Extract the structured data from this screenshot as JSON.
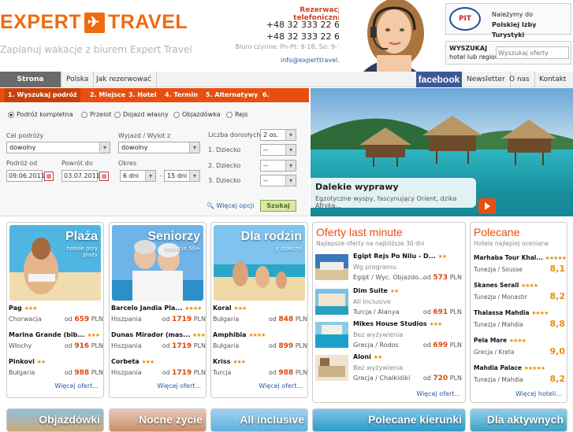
{
  "header": {
    "logo_left": "EXPERT",
    "logo_right": "TRAVEL",
    "tagline": "Zaplanuj wakacje z biurem Expert Travel",
    "phone_label": "Rezerwacja telefoniczna:",
    "phones": [
      "+48 32 333 22 61",
      "+48 32 333 22 69"
    ],
    "hours": "Biuro czynne: Pn-Pt: 9-18, So: 9-13",
    "email": "info@experttravel.pl",
    "pit_logo": "PIT",
    "pit_text_1": "Należymy do",
    "pit_text_2": "Polskiej Izby Turystyki",
    "search_label_1": "WYSZUKAJ",
    "search_label_2": "hotel lub region",
    "search_placeholder": "Wyszukaj oferty"
  },
  "nav": {
    "items": [
      "Strona główna",
      "Polska",
      "Jak rezerwować"
    ],
    "facebook": "facebook",
    "right_items": [
      "Newsletter",
      "O nas",
      "Kontakt"
    ]
  },
  "steps": [
    "1. Wyszukaj podróż",
    "2. Miejsce",
    "3. Hotel",
    "4. Termin",
    "5. Alternatywy",
    "6. Rezerwacja"
  ],
  "search": {
    "radios": [
      "Podróż kompletna",
      "Przelot",
      "Dojazd własny",
      "Objazdówka",
      "Rejs"
    ],
    "origin_label": "Cel podróży",
    "origin_value": "dowolny",
    "depart_label": "Wyjazd / Wylot z",
    "depart_value": "dowolny",
    "from_label": "Podróż od",
    "from_value": "09.06.2011",
    "to_label": "Powrót do",
    "to_value": "03.07.2011",
    "period_label": "Okres",
    "period_from": "6 dni",
    "period_sep": "-",
    "period_to": "15 dni",
    "adults_label": "Liczba dorosłych",
    "adults_value": "2 os.",
    "child1_label": "1. Dziecko",
    "child2_label": "2. Dziecko",
    "child3_label": "3. Dziecko",
    "child_value": "--",
    "more_options": "Więcej opcji",
    "submit": "Szukaj"
  },
  "hero": {
    "title": "Dalekie wyprawy",
    "subtitle": "Egzotyczne wyspy, fascynujący Orient, dzika Afryka..."
  },
  "cards": [
    {
      "title": "Plaża",
      "subtitle": "hotele przy plaży",
      "offers": [
        {
          "name": "Pag",
          "stars": "★★★",
          "country": "Chorwacja",
          "price_prefix": "od",
          "price": "659",
          "currency": "PLN"
        },
        {
          "name": "Marina Grande (bib...",
          "stars": "★★★",
          "country": "Włochy",
          "price_prefix": "od",
          "price": "916",
          "currency": "PLN"
        },
        {
          "name": "Pinkovi",
          "stars": "★★",
          "country": "Bułgaria",
          "price_prefix": "od",
          "price": "988",
          "currency": "PLN"
        }
      ],
      "more": "Więcej ofert..."
    },
    {
      "title": "Seniorzy",
      "subtitle": "wakacje 50+",
      "offers": [
        {
          "name": "Barcelo Jandia Pla...",
          "stars": "★★★★",
          "country": "Hiszpania",
          "price_prefix": "od",
          "price": "1719",
          "currency": "PLN"
        },
        {
          "name": "Dunas Mirador (mas...",
          "stars": "★★★★",
          "country": "Hiszpania",
          "price_prefix": "od",
          "price": "1719",
          "currency": "PLN"
        },
        {
          "name": "Corbeta",
          "stars": "★★★",
          "country": "Hiszpania",
          "price_prefix": "od",
          "price": "1719",
          "currency": "PLN"
        }
      ],
      "more": "Więcej ofert..."
    },
    {
      "title": "Dla rodzin",
      "subtitle": "z dziećmi",
      "offers": [
        {
          "name": "Koral",
          "stars": "★★★",
          "country": "Bułgaria",
          "price_prefix": "od",
          "price": "848",
          "currency": "PLN"
        },
        {
          "name": "Amphibia",
          "stars": "★★★★",
          "country": "Bułgaria",
          "price_prefix": "od",
          "price": "899",
          "currency": "PLN"
        },
        {
          "name": "Kriss",
          "stars": "★★★",
          "country": "Turcja",
          "price_prefix": "od",
          "price": "988",
          "currency": "PLN"
        }
      ],
      "more": "Więcej ofert..."
    }
  ],
  "last_minute": {
    "title": "Oferty last minute",
    "subtitle": "Najlepsze oferty na najbliższe 30 dni",
    "items": [
      {
        "name": "Egipt Rejs Po Nilu - D...",
        "stars": "★★",
        "desc": "Wg programu",
        "country": "Egipt / Wyc. Objazdo...",
        "price_prefix": "od",
        "price": "573",
        "currency": "PLN"
      },
      {
        "name": "Dim Suite",
        "stars": "★★",
        "desc": "All Inclusive",
        "country": "Turcja / Alanya",
        "price_prefix": "od",
        "price": "691",
        "currency": "PLN"
      },
      {
        "name": "Mikes House Studios",
        "stars": "★★★",
        "desc": "Bez wyżywienia",
        "country": "Grecja / Rodos",
        "price_prefix": "od",
        "price": "699",
        "currency": "PLN"
      },
      {
        "name": "Aloni",
        "stars": "★★",
        "desc": "Bez wyżywienia",
        "country": "Grecja / Chalkidiki",
        "price_prefix": "od",
        "price": "720",
        "currency": "PLN"
      }
    ],
    "more": "Więcej ofert..."
  },
  "polecane": {
    "title": "Polecane",
    "subtitle": "Hotele najlepiej oceniane",
    "items": [
      {
        "name": "Marhaba Tour Khal...",
        "stars": "★★★★★",
        "country": "Tunezja / Sousse",
        "score": "8,1"
      },
      {
        "name": "Skanes Serail",
        "stars": "★★★★",
        "country": "Tunezja / Monastir",
        "score": "8,2"
      },
      {
        "name": "Thalassa Mahdia",
        "stars": "★★★★",
        "country": "Tunezja / Mahdia",
        "score": "8,8"
      },
      {
        "name": "Pela Mare",
        "stars": "★★★★",
        "country": "Grecja / Kreta",
        "score": "9,0"
      },
      {
        "name": "Mahdia Palace",
        "stars": "★★★★★",
        "country": "Tunezja / Mahdia",
        "score": "8,2"
      }
    ],
    "more": "Więcej hoteli..."
  },
  "bottom_cards": [
    "Objazdówki",
    "Nocne życie",
    "All inclusive",
    "Polecane kierunki",
    "Dla aktywnych"
  ],
  "colors": {
    "brand": "#f06a10",
    "accent": "#e84e0f",
    "link": "#2a5aa5",
    "star": "#e8910c"
  }
}
